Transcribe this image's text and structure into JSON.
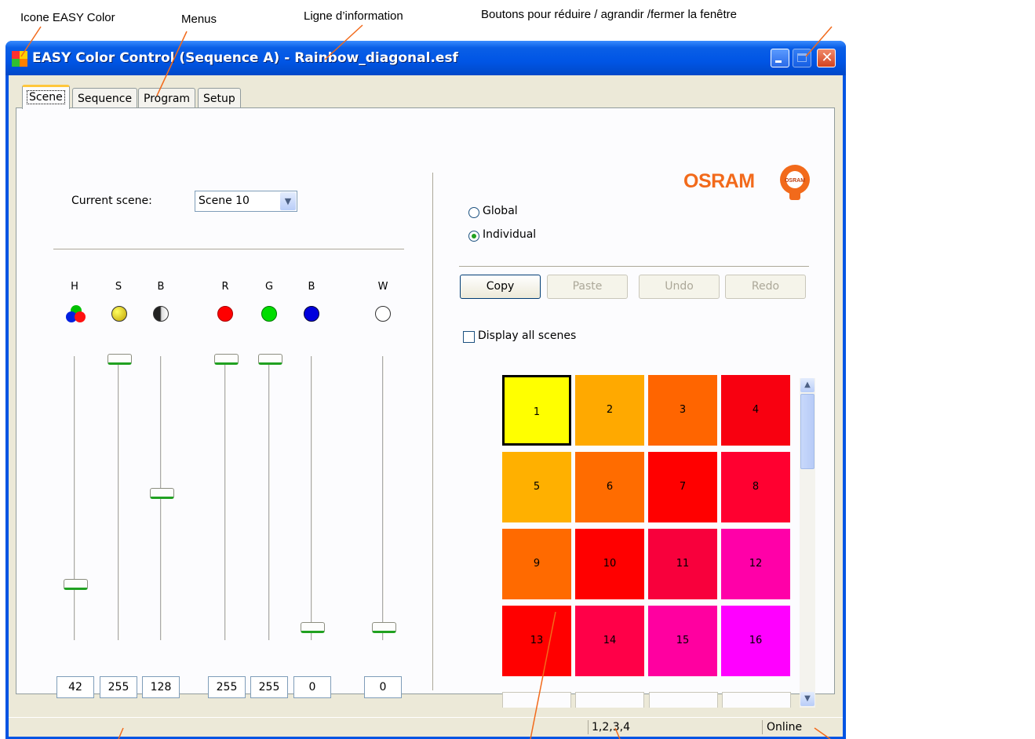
{
  "annotations": {
    "icon": "Icone EASY Color",
    "menus": "Menus",
    "info_line": "Ligne d’information",
    "window_buttons": "Boutons pour  réduire / agrandir /fermer la fenêtre"
  },
  "window": {
    "title": "EASY Color Control (Sequence A) - Rainbow_diagonal.esf",
    "buttons": [
      "minimize",
      "maximize",
      "close"
    ]
  },
  "tabs": [
    {
      "label": "Scene",
      "active": true
    },
    {
      "label": "Sequence",
      "active": false
    },
    {
      "label": "Program",
      "active": false
    },
    {
      "label": "Setup",
      "active": false
    }
  ],
  "scene": {
    "current_label": "Current scene:",
    "current_value": "Scene 10"
  },
  "channels": [
    {
      "label": "H",
      "value": "42",
      "level": 0.16
    },
    {
      "label": "S",
      "value": "255",
      "level": 1.0
    },
    {
      "label": "B",
      "value": "128",
      "level": 0.5
    },
    {
      "label": "R",
      "value": "255",
      "level": 1.0
    },
    {
      "label": "G",
      "value": "255",
      "level": 1.0
    },
    {
      "label": "B",
      "value": "0",
      "level": 0.0
    },
    {
      "label": "W",
      "value": "0",
      "level": 0.0
    }
  ],
  "colors": {
    "accent": "#0054e3",
    "osram": "#f26a1b",
    "red": "#ff0000",
    "green": "#00dd00",
    "blue": "#0000dd"
  },
  "mode": {
    "global_label": "Global",
    "individual_label": "Individual",
    "selected": "Individual"
  },
  "actions": {
    "copy": "Copy",
    "paste": "Paste",
    "undo": "Undo",
    "redo": "Redo"
  },
  "display_all": {
    "label": "Display all scenes",
    "checked": false
  },
  "logo": {
    "text": "OSRAM",
    "badge": "OSRAM"
  },
  "scenes": [
    {
      "n": "1",
      "color": "#ffff00",
      "selected": true
    },
    {
      "n": "2",
      "color": "#ffa900"
    },
    {
      "n": "3",
      "color": "#ff6500"
    },
    {
      "n": "4",
      "color": "#f80010"
    },
    {
      "n": "5",
      "color": "#ffb000"
    },
    {
      "n": "6",
      "color": "#ff6c00"
    },
    {
      "n": "7",
      "color": "#ff0000"
    },
    {
      "n": "8",
      "color": "#ff0030"
    },
    {
      "n": "9",
      "color": "#ff6a00"
    },
    {
      "n": "10",
      "color": "#ff0000"
    },
    {
      "n": "11",
      "color": "#f8003c"
    },
    {
      "n": "12",
      "color": "#ff00a8"
    },
    {
      "n": "13",
      "color": "#ff0000"
    },
    {
      "n": "14",
      "color": "#ff0048"
    },
    {
      "n": "15",
      "color": "#ff00a0"
    },
    {
      "n": "16",
      "color": "#ff00ff"
    }
  ],
  "status": {
    "universes": "1,2,3,4",
    "connection": "Online"
  }
}
